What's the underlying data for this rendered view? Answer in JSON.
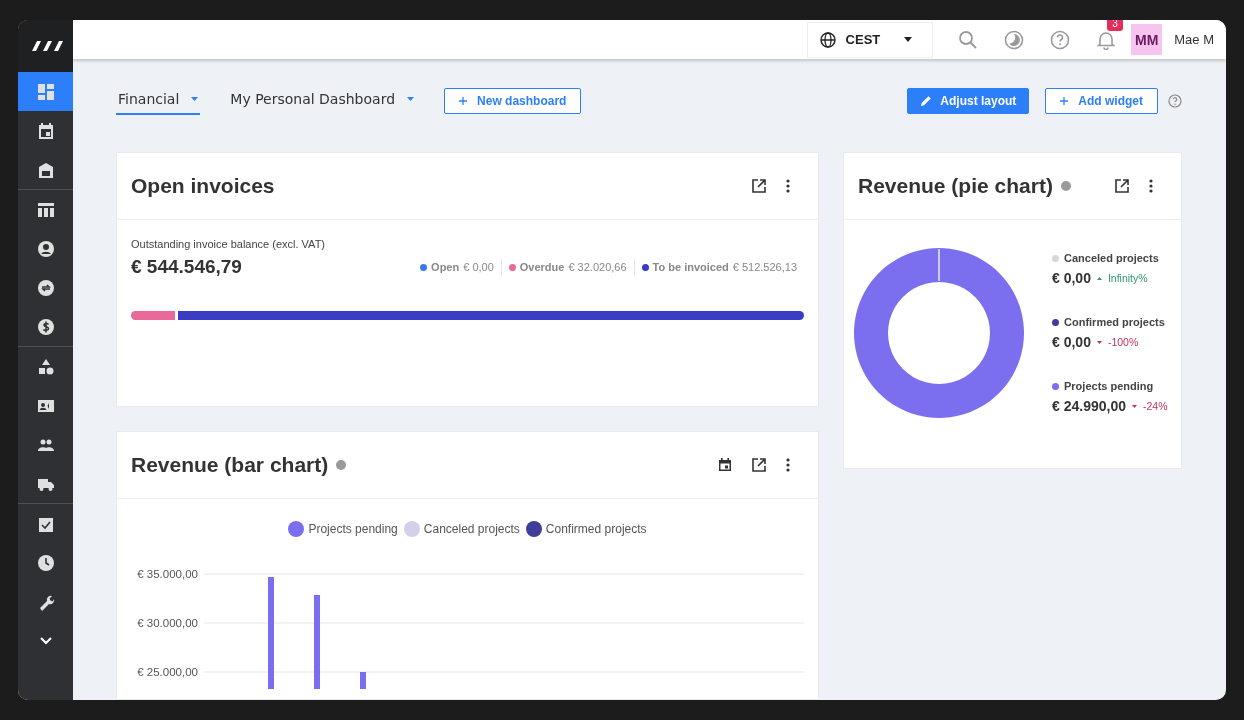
{
  "sidebar": {
    "groups": [
      [
        {
          "selected": true
        },
        {
          "selected": false
        },
        {
          "selected": false
        }
      ],
      [
        {
          "selected": false
        },
        {
          "selected": false
        },
        {
          "selected": false
        },
        {
          "selected": false
        }
      ],
      [
        {
          "selected": false
        },
        {
          "selected": false
        },
        {
          "selected": false
        },
        {
          "selected": false
        }
      ],
      [
        {
          "selected": false
        },
        {
          "selected": false
        },
        {
          "selected": false
        },
        {
          "selected": false
        }
      ]
    ]
  },
  "header": {
    "timezone": "CEST",
    "notifications": "3",
    "avatar": "MM",
    "user": "Mae M"
  },
  "tabs": [
    {
      "label": "Financial",
      "selected": true
    },
    {
      "label": "My Personal Dashboard",
      "selected": false
    }
  ],
  "toolbar": {
    "new_dashboard": "New dashboard",
    "adjust_layout": "Adjust layout",
    "add_widget": "Add widget"
  },
  "open_invoices": {
    "title": "Open invoices",
    "caption": "Outstanding invoice balance (excl. VAT)",
    "total": "€ 544.546,79",
    "segments": [
      {
        "label": "Open",
        "amount": "€ 0,00",
        "color": "#3a7bea"
      },
      {
        "label": "Overdue",
        "amount": "€ 32.020,66",
        "color": "#e8699a",
        "level": 0.065
      },
      {
        "label": "To be invoiced",
        "amount": "€ 512.526,13",
        "color": "#3b3cc4",
        "level": 0.935
      }
    ]
  },
  "revenue_pie": {
    "title": "Revenue (pie chart)",
    "legend": [
      {
        "label": "Canceled projects",
        "amount": "€ 0,00",
        "change": "Infinity%",
        "rising": true,
        "color": "#d6d6dc"
      },
      {
        "label": "Confirmed projects",
        "amount": "€ 0,00",
        "change": "-100%",
        "rising": false,
        "color": "#3f3d99"
      },
      {
        "label": "Projects pending",
        "amount": "€ 24.990,00",
        "change": "-24%",
        "rising": false,
        "color": "#7b6ff0"
      }
    ]
  },
  "revenue_bar": {
    "title": "Revenue (bar chart)",
    "legend": [
      {
        "name": "Projects pending",
        "color": "#7b6ff0"
      },
      {
        "name": "Canceled projects",
        "color": "#d3d1ea"
      },
      {
        "name": "Confirmed projects",
        "color": "#3f3d99"
      }
    ],
    "y_axis_labels": [
      "€ 35.000,00",
      "€ 30.000,00",
      "€ 25.000,00"
    ]
  }
}
